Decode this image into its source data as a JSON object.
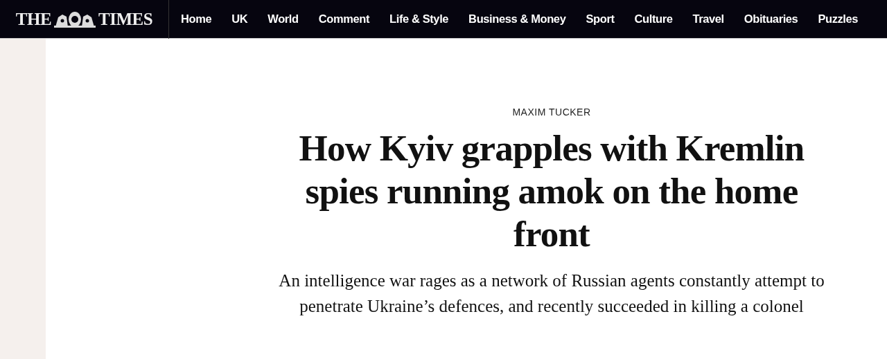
{
  "masthead": {
    "logo_left": "THE",
    "logo_right": "TIMES"
  },
  "nav": [
    "Home",
    "UK",
    "World",
    "Comment",
    "Life & Style",
    "Business & Money",
    "Sport",
    "Culture",
    "Travel",
    "Obituaries",
    "Puzzles"
  ],
  "article": {
    "author": "MAXIM TUCKER",
    "headline": "How Kyiv grapples with Kremlin spies running amok on the home front",
    "standfirst": "An intelligence war rages as a network of Russian agents constantly attempt to penetrate Ukraine’s defences, and recently succeeded in killing a colonel"
  }
}
